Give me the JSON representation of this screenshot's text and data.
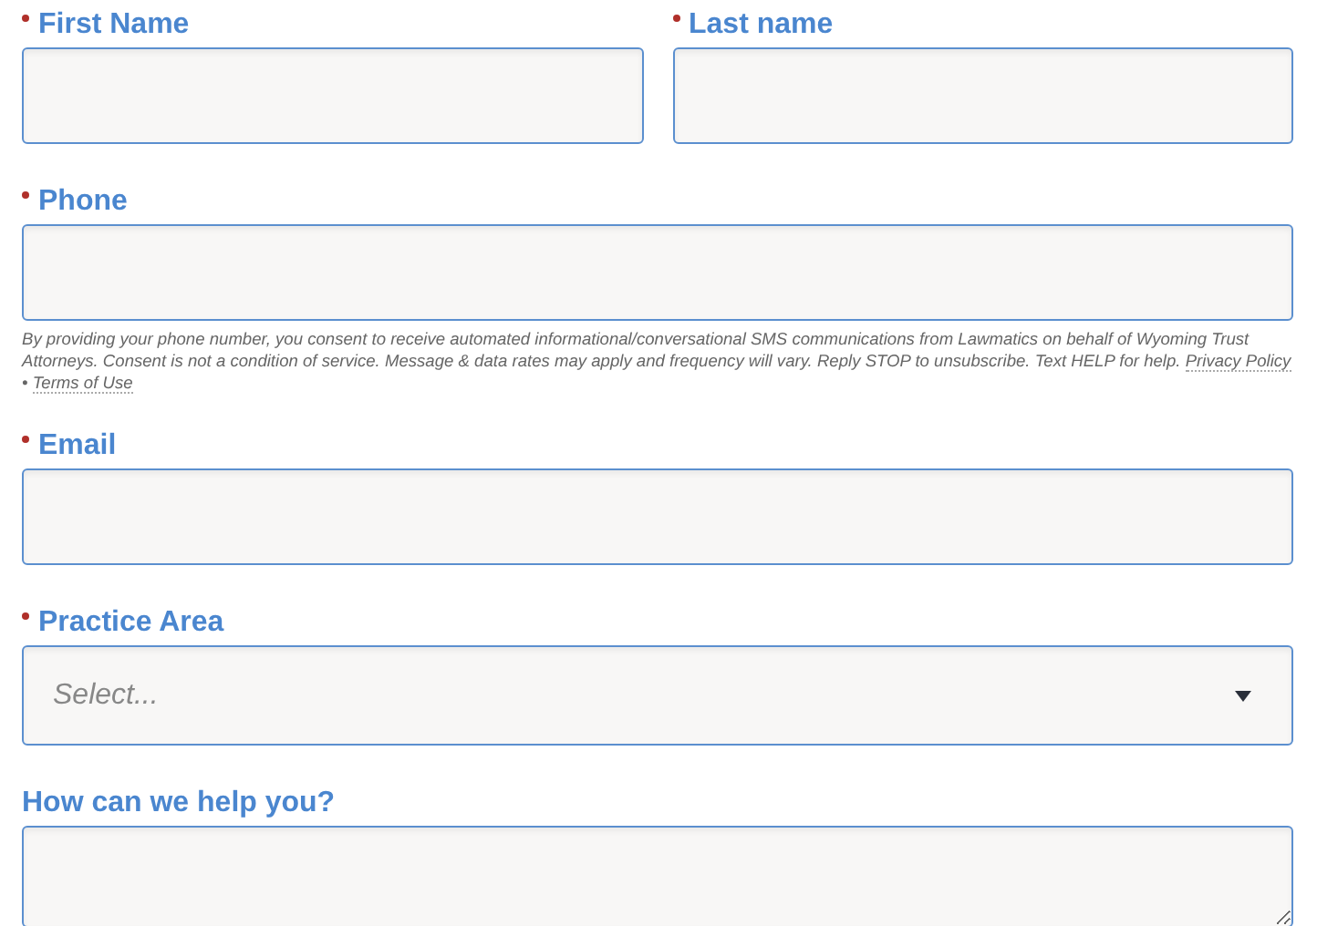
{
  "rows": [
    {
      "fields": [
        {
          "kind": "text",
          "label": "First Name",
          "required": true
        },
        {
          "kind": "text",
          "label": "Last name",
          "required": true
        }
      ]
    },
    {
      "fields": [
        {
          "kind": "text",
          "label": "Phone",
          "required": true
        }
      ],
      "disclaimer": {
        "text": "By providing your phone number, you consent to receive automated informational/conversational SMS communications from Lawmatics on behalf of Wyoming Trust Attorneys. Consent is not a condition of service. Message & data rates may apply and frequency will vary. Reply STOP to unsubscribe. Text HELP for help.",
        "links": [
          "Privacy Policy",
          "Terms of Use"
        ],
        "separator": "•"
      }
    },
    {
      "fields": [
        {
          "kind": "text",
          "label": "Email",
          "required": true
        }
      ]
    },
    {
      "fields": [
        {
          "kind": "select",
          "label": "Practice Area",
          "required": true,
          "placeholder": "Select..."
        }
      ]
    },
    {
      "fields": [
        {
          "kind": "textarea",
          "label": "How can we help you?",
          "required": false
        }
      ]
    }
  ]
}
